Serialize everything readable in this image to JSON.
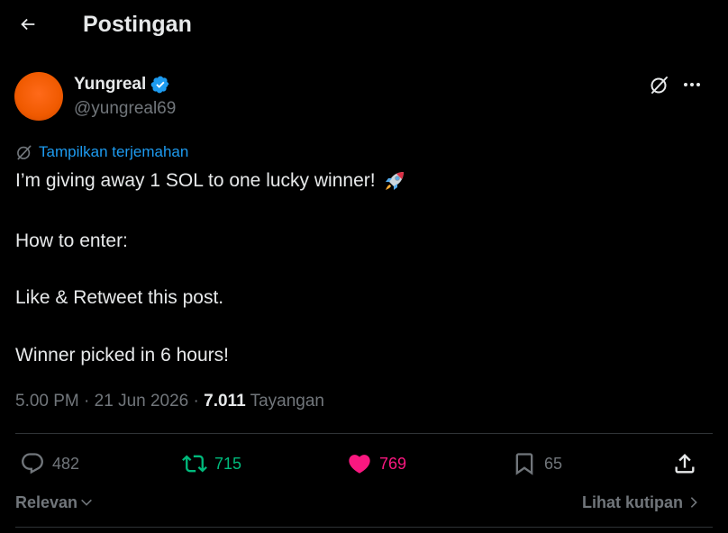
{
  "header": {
    "title": "Postingan"
  },
  "author": {
    "display_name": "Yungreal",
    "handle": "@yungreal69"
  },
  "post": {
    "translate_label": "Tampilkan terjemahan",
    "line1": "I’m giving away 1 SOL to one lucky winner!",
    "line2": "How to enter:",
    "line3": "Like & Retweet this post.",
    "line4": "Winner picked in 6 hours!",
    "time": "5.00 PM",
    "date": "21 Jun 2026",
    "views_count": "7.011",
    "views_label": "Tayangan"
  },
  "actions": {
    "replies": "482",
    "reposts": "715",
    "likes": "769",
    "bookmarks": "65"
  },
  "footer": {
    "sort_label": "Relevan",
    "quotes_label": "Lihat kutipan"
  },
  "colors": {
    "accent": "#1d9bf0",
    "repost": "#00ba7c",
    "like": "#f91880",
    "muted": "#71767b",
    "text": "#e7e9ea",
    "avatar": "#f05a00"
  },
  "icons": [
    "back-arrow-icon",
    "verified-badge-icon",
    "grok-icon",
    "more-icon",
    "translate-icon",
    "rocket-emoji-icon",
    "reply-icon",
    "repost-icon",
    "heart-icon",
    "bookmark-icon",
    "share-icon",
    "chevron-down-icon",
    "chevron-right-icon"
  ]
}
